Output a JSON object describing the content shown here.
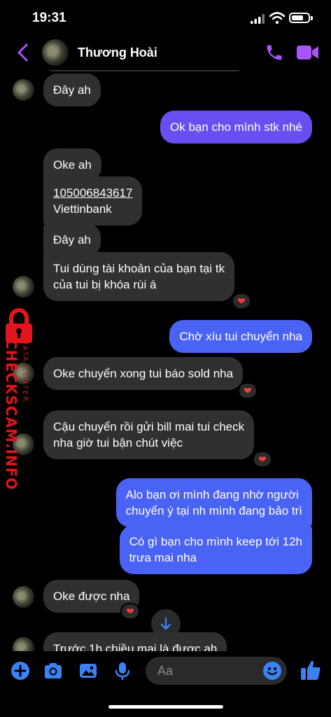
{
  "status": {
    "time": "19:31"
  },
  "header": {
    "contact_name": "Thương Hoài"
  },
  "messages": [
    {
      "text": "Đây ah"
    },
    {
      "text": "Ok bạn cho mình stk nhé"
    },
    {
      "text": "Oke ah"
    },
    {
      "account_number": "105006843617",
      "bank": "Viettinbank"
    },
    {
      "text": "Đây ah"
    },
    {
      "line1": "Tui dùng tài khoản của bạn tại tk",
      "line2": "của tui bị khóa rùi á",
      "reaction": "❤"
    },
    {
      "text": "Chờ xíu tui chuyển nha"
    },
    {
      "text": "Oke chuyển xong tui báo sold nha",
      "reaction": "❤"
    },
    {
      "line1": "Cậu chuyển rồi gửi bill mai tui check",
      "line2": "nha giờ tui bận chút việc",
      "reaction": "❤"
    },
    {
      "line1": "Alo bạn ơi mình đang nhờ người",
      "line2": "chuyển ý tại nh mình đang bảo trì"
    },
    {
      "line1": "Có gì bạn cho mình keep tới 12h",
      "line2": "trưa mai nha"
    },
    {
      "text": "Oke được nha",
      "reaction": "❤"
    },
    {
      "text": "Trước 1h chiều mai là được ah"
    }
  ],
  "watermark": {
    "brand": "CHECKSCAM.INFO",
    "sub": "DATA CENTER"
  },
  "composer": {
    "placeholder": "Aa"
  },
  "colors": {
    "accent": "#a855f7",
    "outgoing": "#5a57f2",
    "incoming": "#303030",
    "composer_icons": "#3b82f6"
  }
}
